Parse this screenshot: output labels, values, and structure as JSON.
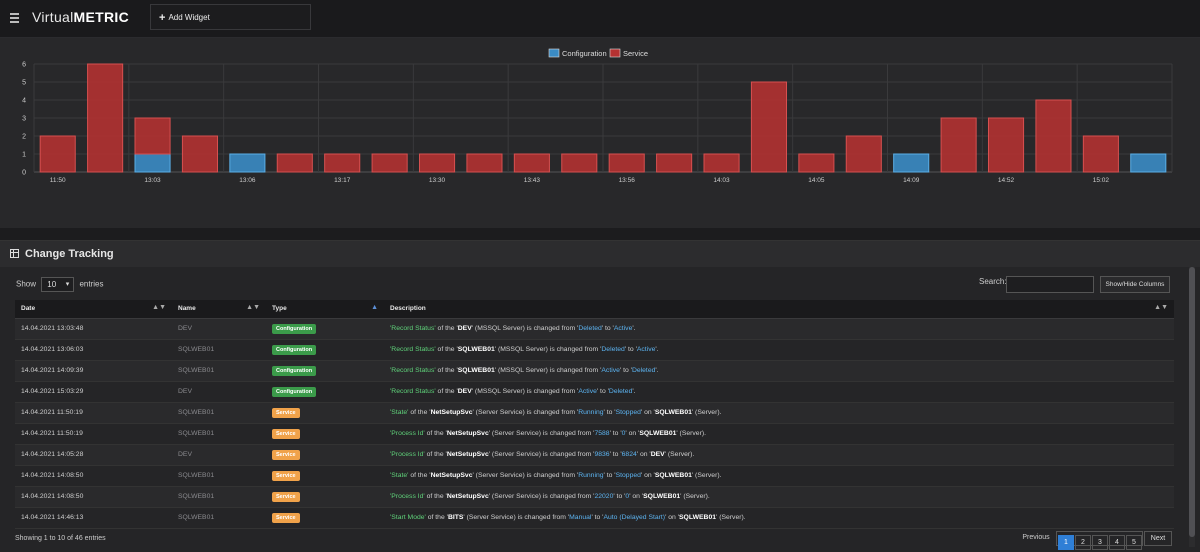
{
  "brand": {
    "logo_pre": "Virtual",
    "logo_post": "METRIC"
  },
  "toolbar": {
    "add_widget": "Add Widget"
  },
  "chart_data": {
    "type": "bar",
    "stacked": true,
    "legend": {
      "position": "top-center",
      "entries": [
        "Configuration",
        "Service"
      ]
    },
    "colors": {
      "Configuration": "#3a8bc4",
      "Service": "#b53131"
    },
    "ylim": [
      0,
      6
    ],
    "yticks": [
      0,
      1,
      2,
      3,
      4,
      5,
      6
    ],
    "xtick_labels": [
      "11:50",
      "13:03",
      "13:06",
      "13:17",
      "13:30",
      "13:43",
      "13:56",
      "14:03",
      "14:05",
      "14:09",
      "14:52",
      "15:02"
    ],
    "xtick_index": [
      0,
      2,
      4,
      6,
      8,
      10,
      12,
      14,
      16,
      18,
      20,
      22
    ],
    "series": [
      {
        "name": "Configuration",
        "values": [
          0,
          0,
          1,
          0,
          1,
          0,
          0,
          0,
          0,
          0,
          0,
          0,
          0,
          0,
          0,
          0,
          0,
          0,
          1,
          0,
          0,
          0,
          0,
          1
        ]
      },
      {
        "name": "Service",
        "values": [
          2,
          6,
          2,
          2,
          0,
          1,
          1,
          1,
          1,
          1,
          1,
          1,
          1,
          1,
          1,
          5,
          1,
          2,
          0,
          3,
          3,
          4,
          2,
          0
        ]
      }
    ],
    "grid": true
  },
  "panel": {
    "title": "Change Tracking"
  },
  "controls": {
    "show": "Show",
    "entries_value": "10",
    "entries": "entries",
    "search_label": "Search:",
    "show_hide": "Show/Hide Columns"
  },
  "table": {
    "headers": [
      "Date",
      "Name",
      "Type",
      "Description"
    ],
    "rows": [
      {
        "date": "14.04.2021 13:03:48",
        "name": "DEV",
        "type": "Configuration",
        "kind": "cfg",
        "desc": [
          [
            "g",
            "'Record Status'"
          ],
          [
            "n",
            " of the '"
          ],
          [
            "w",
            "DEV"
          ],
          [
            "n",
            "' (MSSQL Server) is changed from '"
          ],
          [
            "bl",
            "Deleted"
          ],
          [
            "n",
            "' to '"
          ],
          [
            "bl",
            "Active"
          ],
          [
            "n",
            "'."
          ]
        ]
      },
      {
        "date": "14.04.2021 13:06:03",
        "name": "SQLWEB01",
        "type": "Configuration",
        "kind": "cfg",
        "desc": [
          [
            "g",
            "'Record Status'"
          ],
          [
            "n",
            " of the '"
          ],
          [
            "w",
            "SQLWEB01"
          ],
          [
            "n",
            "' (MSSQL Server) is changed from '"
          ],
          [
            "bl",
            "Deleted"
          ],
          [
            "n",
            "' to '"
          ],
          [
            "bl",
            "Active"
          ],
          [
            "n",
            "'."
          ]
        ]
      },
      {
        "date": "14.04.2021 14:09:39",
        "name": "SQLWEB01",
        "type": "Configuration",
        "kind": "cfg",
        "desc": [
          [
            "g",
            "'Record Status'"
          ],
          [
            "n",
            " of the '"
          ],
          [
            "w",
            "SQLWEB01"
          ],
          [
            "n",
            "' (MSSQL Server) is changed from '"
          ],
          [
            "bl",
            "Active"
          ],
          [
            "n",
            "' to '"
          ],
          [
            "bl",
            "Deleted"
          ],
          [
            "n",
            "'."
          ]
        ]
      },
      {
        "date": "14.04.2021 15:03:29",
        "name": "DEV",
        "type": "Configuration",
        "kind": "cfg",
        "desc": [
          [
            "g",
            "'Record Status'"
          ],
          [
            "n",
            " of the '"
          ],
          [
            "w",
            "DEV"
          ],
          [
            "n",
            "' (MSSQL Server) is changed from '"
          ],
          [
            "bl",
            "Active"
          ],
          [
            "n",
            "' to '"
          ],
          [
            "bl",
            "Deleted"
          ],
          [
            "n",
            "'."
          ]
        ]
      },
      {
        "date": "14.04.2021 11:50:19",
        "name": "SQLWEB01",
        "type": "Service",
        "kind": "svc",
        "desc": [
          [
            "g",
            "'State'"
          ],
          [
            "n",
            " of the '"
          ],
          [
            "w",
            "NetSetupSvc"
          ],
          [
            "n",
            "' (Server Service) is changed from '"
          ],
          [
            "bl",
            "Running"
          ],
          [
            "n",
            "' to '"
          ],
          [
            "bl",
            "Stopped"
          ],
          [
            "n",
            "' on '"
          ],
          [
            "w",
            "SQLWEB01"
          ],
          [
            "n",
            "' (Server)."
          ]
        ]
      },
      {
        "date": "14.04.2021 11:50:19",
        "name": "SQLWEB01",
        "type": "Service",
        "kind": "svc",
        "desc": [
          [
            "g",
            "'Process Id'"
          ],
          [
            "n",
            " of the '"
          ],
          [
            "w",
            "NetSetupSvc"
          ],
          [
            "n",
            "' (Server Service) is changed from '"
          ],
          [
            "bl",
            "7588"
          ],
          [
            "n",
            "' to '"
          ],
          [
            "bl",
            "0"
          ],
          [
            "n",
            "' on '"
          ],
          [
            "w",
            "SQLWEB01"
          ],
          [
            "n",
            "' (Server)."
          ]
        ]
      },
      {
        "date": "14.04.2021 14:05:28",
        "name": "DEV",
        "type": "Service",
        "kind": "svc",
        "desc": [
          [
            "g",
            "'Process Id'"
          ],
          [
            "n",
            " of the '"
          ],
          [
            "w",
            "NetSetupSvc"
          ],
          [
            "n",
            "' (Server Service) is changed from '"
          ],
          [
            "bl",
            "9836"
          ],
          [
            "n",
            "' to '"
          ],
          [
            "bl",
            "6824"
          ],
          [
            "n",
            "' on '"
          ],
          [
            "w",
            "DEV"
          ],
          [
            "n",
            "' (Server)."
          ]
        ]
      },
      {
        "date": "14.04.2021 14:08:50",
        "name": "SQLWEB01",
        "type": "Service",
        "kind": "svc",
        "desc": [
          [
            "g",
            "'State'"
          ],
          [
            "n",
            " of the '"
          ],
          [
            "w",
            "NetSetupSvc"
          ],
          [
            "n",
            "' (Server Service) is changed from '"
          ],
          [
            "bl",
            "Running"
          ],
          [
            "n",
            "' to '"
          ],
          [
            "bl",
            "Stopped"
          ],
          [
            "n",
            "' on '"
          ],
          [
            "w",
            "SQLWEB01"
          ],
          [
            "n",
            "' (Server)."
          ]
        ]
      },
      {
        "date": "14.04.2021 14:08:50",
        "name": "SQLWEB01",
        "type": "Service",
        "kind": "svc",
        "desc": [
          [
            "g",
            "'Process Id'"
          ],
          [
            "n",
            " of the '"
          ],
          [
            "w",
            "NetSetupSvc"
          ],
          [
            "n",
            "' (Server Service) is changed from '"
          ],
          [
            "bl",
            "22020"
          ],
          [
            "n",
            "' to '"
          ],
          [
            "bl",
            "0"
          ],
          [
            "n",
            "' on '"
          ],
          [
            "w",
            "SQLWEB01"
          ],
          [
            "n",
            "' (Server)."
          ]
        ]
      },
      {
        "date": "14.04.2021 14:46:13",
        "name": "SQLWEB01",
        "type": "Service",
        "kind": "svc",
        "desc": [
          [
            "g",
            "'Start Mode'"
          ],
          [
            "n",
            " of the '"
          ],
          [
            "w",
            "BITS"
          ],
          [
            "n",
            "' (Server Service) is changed from '"
          ],
          [
            "bl",
            "Manual"
          ],
          [
            "n",
            "' to '"
          ],
          [
            "bl",
            "Auto (Delayed Start)"
          ],
          [
            "n",
            "' on '"
          ],
          [
            "w",
            "SQLWEB01"
          ],
          [
            "n",
            "' (Server)."
          ]
        ]
      }
    ]
  },
  "footer": {
    "info": "Showing 1 to 10 of 46 entries",
    "prev": "Previous",
    "pages": [
      "1",
      "2",
      "3",
      "4",
      "5"
    ],
    "active_page": "1",
    "next": "Next"
  }
}
